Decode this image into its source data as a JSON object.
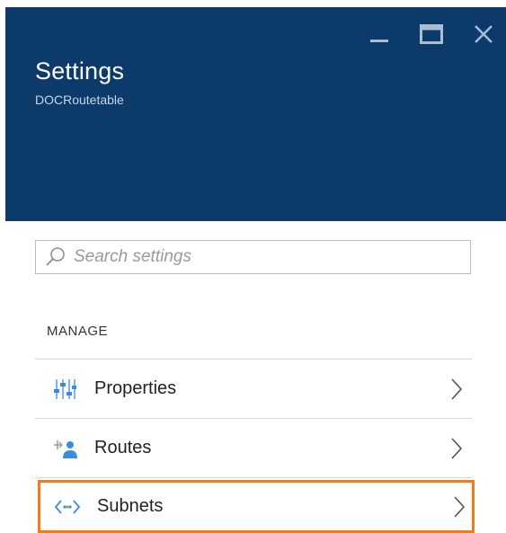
{
  "window": {
    "title": "Settings",
    "subtitle": "DOCRoutetable",
    "controls": [
      "minimize-icon",
      "maximize-icon",
      "close-icon"
    ]
  },
  "search": {
    "placeholder": "Search settings",
    "value": ""
  },
  "section": {
    "label": "MANAGE"
  },
  "items": [
    {
      "label": "Properties",
      "icon": "properties-icon"
    },
    {
      "label": "Routes",
      "icon": "routes-icon"
    },
    {
      "label": "Subnets",
      "icon": "subnets-icon",
      "highlighted": true
    }
  ],
  "colors": {
    "header_bg": "#0b3a6b",
    "highlight": "#ef7d1b",
    "icon_blue": "#3a8dde"
  }
}
